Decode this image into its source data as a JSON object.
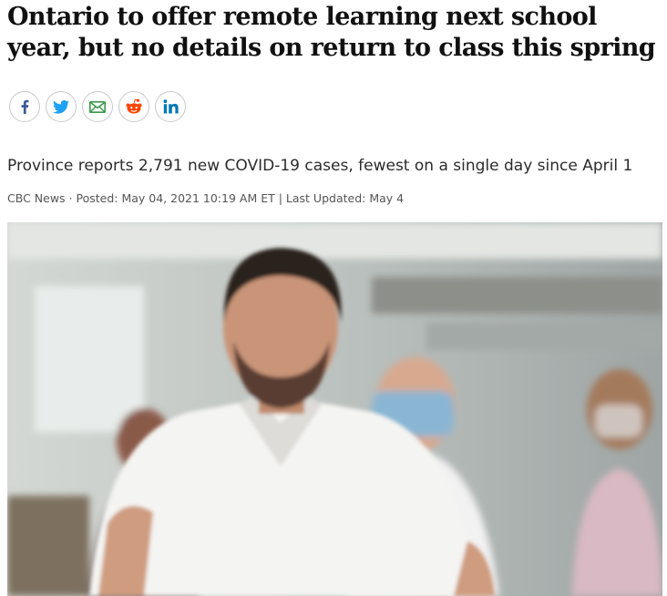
{
  "article": {
    "headline": "Ontario to offer remote learning next school year, but no details on return to class this spring",
    "deck": "Province reports 2,791 new COVID-19 cases, fewest on a single day since April 1",
    "byline": {
      "source": "CBC News",
      "separator": " · ",
      "posted": "Posted: May 04, 2021 10:19 AM ET",
      "divider": " | ",
      "updated": "Last Updated: May 4"
    }
  },
  "share": [
    {
      "name": "facebook-icon",
      "color": "#3b5998"
    },
    {
      "name": "twitter-icon",
      "color": "#1da1f2"
    },
    {
      "name": "email-icon",
      "color": "#3a9a4c"
    },
    {
      "name": "reddit-icon",
      "color": "#ff4500"
    },
    {
      "name": "linkedin-icon",
      "color": "#0077b5"
    }
  ]
}
